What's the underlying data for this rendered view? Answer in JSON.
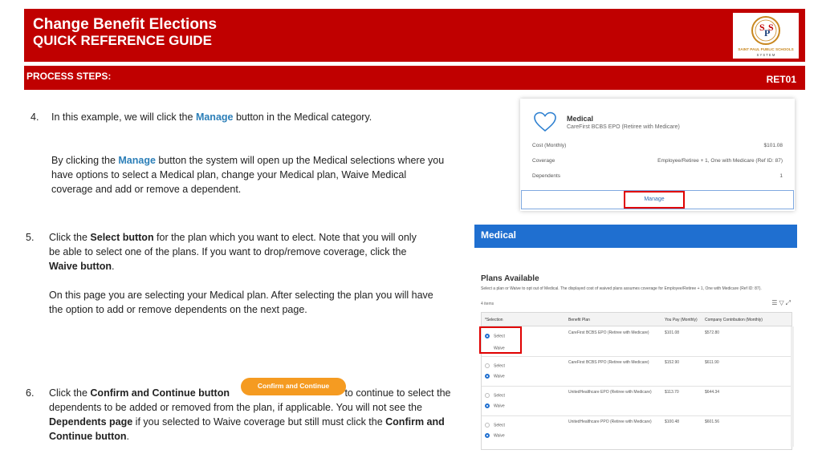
{
  "header": {
    "title_line1": "Change Benefit Elections",
    "title_line2": "QUICK REFERENCE GUIDE",
    "logo_letters": "SPS",
    "logo_text": "SAINT PAUL PUBLIC SCHOOLS",
    "logo_sub": "S Y S T E M"
  },
  "process_bar": {
    "label": "PROCESS STEPS:",
    "code": "RET01"
  },
  "steps": {
    "s4_num": "4.",
    "s4_a": "In this example, we will click the ",
    "s4_b": "Manage",
    "s4_c": " button in the Medical category.",
    "s4p_a": "By clicking the ",
    "s4p_b": "Manage",
    "s4p_c": " button the system will open up the Medical selections where you have options to select a Medical plan, change your Medical plan, Waive Medical coverage and add or remove a dependent.",
    "s5_num": "5.",
    "s5_a": "Click the ",
    "s5_b": "Select button",
    "s5_c": " for the plan which you want to elect. Note that you will only be able to select one of the plans. If you want to drop/remove coverage, click the ",
    "s5_d": "Waive button",
    "s5_e": ".",
    "s5p": "On this page you are selecting your Medical plan.  After selecting the plan you will have the option to add or remove dependents on the next page.",
    "s6_num": "6.",
    "s6_a": "Click the ",
    "s6_b": "Confirm and Continue button",
    "s6_c": " to continue to select the dependents to be added or removed from the plan, if applicable. You will not see the ",
    "s6_d": "Dependents page",
    "s6_e": " if you selected to Waive coverage but still must click the ",
    "s6_f": "Confirm and Continue button",
    "s6_g": ".",
    "confirm_button": "Confirm and Continue"
  },
  "medical_card": {
    "title": "Medical",
    "plan": "CareFirst BCBS EPO (Retiree with Medicare)",
    "rows": [
      {
        "label": "Cost (Monthly)",
        "value": "$101.08"
      },
      {
        "label": "Coverage",
        "value": "Employee/Retiree + 1, One with Medicare (Ref ID: 87)"
      },
      {
        "label": "Dependents",
        "value": "1"
      }
    ],
    "manage_label": "Manage"
  },
  "plans_screen": {
    "header": "Medical",
    "title": "Plans Available",
    "description": "Select a plan or Waive to opt out of Medical. The displayed cost of waived plans assumes coverage for Employee/Retiree + 1, One with Medicare (Ref ID: 87).",
    "count": "4 items",
    "columns": [
      "*Selection",
      "Benefit Plan",
      "You Pay (Monthly)",
      "Company Contribution (Monthly)"
    ],
    "rows": [
      {
        "plan": "CareFirst BCBS EPO (Retiree with Medicare)",
        "pay": "$101.08",
        "contrib": "$572.80",
        "selected": "Select"
      },
      {
        "plan": "CareFirst BCBS PPO (Retiree with Medicare)",
        "pay": "$152.90",
        "contrib": "$611.90",
        "selected": "Waive"
      },
      {
        "plan": "UnitedHealthcare EPO (Retiree with Medicare)",
        "pay": "$113.70",
        "contrib": "$644.34",
        "selected": "Waive"
      },
      {
        "plan": "UnitedHealthcare PPO (Retiree with Medicare)",
        "pay": "$100.48",
        "contrib": "$601.56",
        "selected": "Waive"
      }
    ],
    "opt_select": "Select",
    "opt_waive": "Waive"
  }
}
